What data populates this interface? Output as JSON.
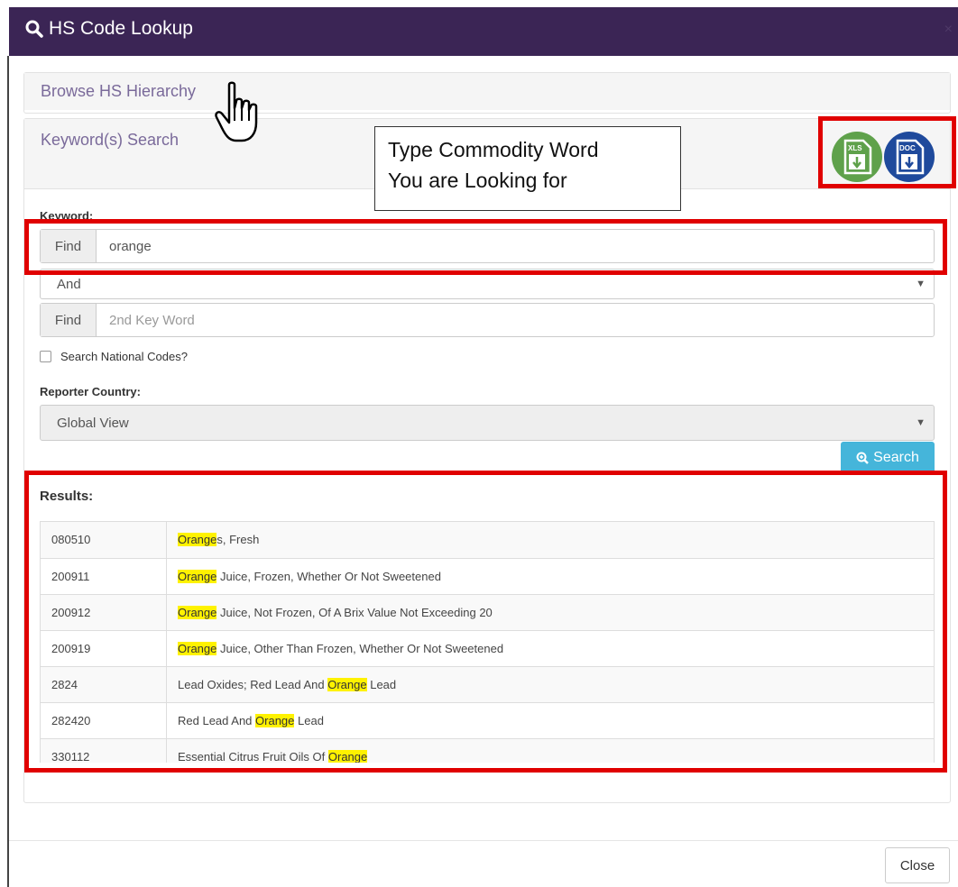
{
  "modal": {
    "title": "HS Code Lookup",
    "close_x": "×",
    "close_label": "Close"
  },
  "panels": {
    "browse_label": "Browse HS Hierarchy",
    "keyword_label": "Keyword(s) Search"
  },
  "callout": {
    "line1": "Type Commodity Word",
    "line2": "You are Looking for"
  },
  "downloads": {
    "xls_label": "XLS",
    "doc_label": "DOC"
  },
  "form": {
    "keyword_label": "Keyword:",
    "find_addon": "Find",
    "keyword_value": "orange",
    "operator_value": "And",
    "find_addon_2": "Find",
    "keyword2_placeholder": "2nd Key Word",
    "national_codes_label": "Search National Codes?",
    "reporter_label": "Reporter Country:",
    "reporter_value": "Global View",
    "search_label": "Search"
  },
  "results": {
    "label": "Results:",
    "rows": [
      {
        "code": "080510",
        "pre": "",
        "hl": "Orange",
        "post": "s, Fresh"
      },
      {
        "code": "200911",
        "pre": "",
        "hl": "Orange",
        "post": " Juice, Frozen, Whether Or Not Sweetened"
      },
      {
        "code": "200912",
        "pre": "",
        "hl": "Orange",
        "post": " Juice, Not Frozen, Of A Brix Value Not Exceeding 20"
      },
      {
        "code": "200919",
        "pre": "",
        "hl": "Orange",
        "post": " Juice, Other Than Frozen, Whether Or Not Sweetened"
      },
      {
        "code": "2824",
        "pre": "Lead Oxides; Red Lead And ",
        "hl": "Orange",
        "post": " Lead"
      },
      {
        "code": "282420",
        "pre": "Red Lead And ",
        "hl": "Orange",
        "post": " Lead"
      },
      {
        "code": "330112",
        "pre": "Essential Citrus Fruit Oils Of ",
        "hl": "Orange",
        "post": ""
      }
    ]
  },
  "colors": {
    "titlebar": "#3b2555",
    "annotation_red": "#e00000",
    "highlight": "#fff200",
    "search_button": "#45b5da"
  }
}
